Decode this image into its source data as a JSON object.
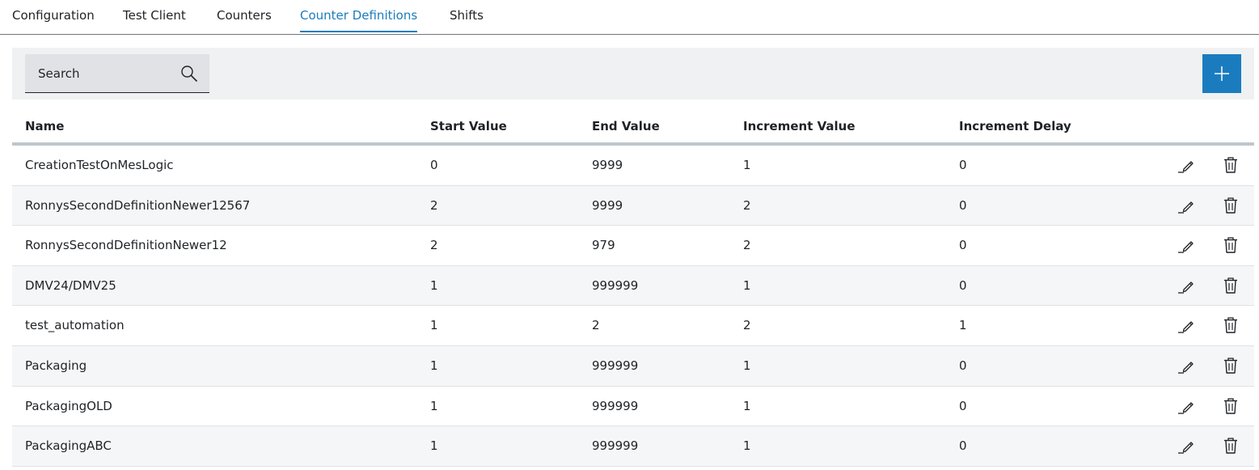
{
  "tabs": [
    {
      "label": "Configuration",
      "active": false
    },
    {
      "label": "Test Client",
      "active": false
    },
    {
      "label": "Counters",
      "active": false
    },
    {
      "label": "Counter Definitions",
      "active": true
    },
    {
      "label": "Shifts",
      "active": false
    }
  ],
  "toolbar": {
    "search_placeholder": "Search",
    "search_icon": "magnifier-icon",
    "add_icon": "plus-icon"
  },
  "table": {
    "columns": [
      "Name",
      "Start Value",
      "End Value",
      "Increment Value",
      "Increment Delay"
    ],
    "rows": [
      {
        "name": "CreationTestOnMesLogic",
        "start": "0",
        "end": "9999",
        "increment": "1",
        "delay": "0"
      },
      {
        "name": "RonnysSecondDefinitionNewer12567",
        "start": "2",
        "end": "9999",
        "increment": "2",
        "delay": "0"
      },
      {
        "name": "RonnysSecondDefinitionNewer12",
        "start": "2",
        "end": "979",
        "increment": "2",
        "delay": "0"
      },
      {
        "name": "DMV24/DMV25",
        "start": "1",
        "end": "999999",
        "increment": "1",
        "delay": "0"
      },
      {
        "name": "test_automation",
        "start": "1",
        "end": "2",
        "increment": "2",
        "delay": "1"
      },
      {
        "name": "Packaging",
        "start": "1",
        "end": "999999",
        "increment": "1",
        "delay": "0"
      },
      {
        "name": "PackagingOLD",
        "start": "1",
        "end": "999999",
        "increment": "1",
        "delay": "0"
      },
      {
        "name": "PackagingABC",
        "start": "1",
        "end": "999999",
        "increment": "1",
        "delay": "0"
      }
    ],
    "row_actions": [
      "edit-icon",
      "delete-icon"
    ]
  },
  "colors": {
    "accent": "#1a7cbf",
    "toolbar_bg": "#eff1f2",
    "search_bg": "#e0e2e5",
    "row_alt_bg": "#f5f6f7"
  }
}
